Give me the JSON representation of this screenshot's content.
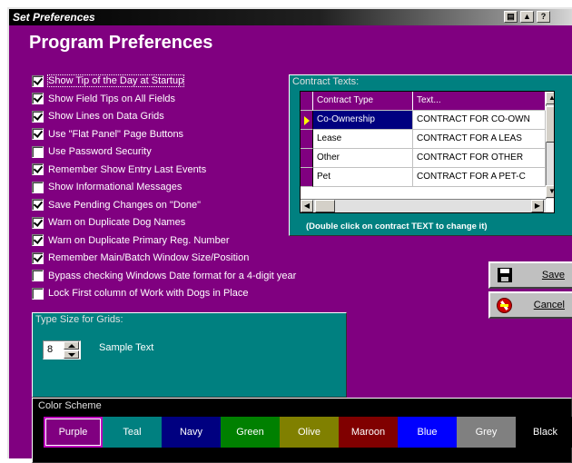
{
  "window": {
    "title": "Set Preferences",
    "heading": "Program Preferences",
    "bg_color": "#800080",
    "title_buttons": [
      "print-icon",
      "export-icon",
      "help-icon"
    ],
    "help_label": "?"
  },
  "options": [
    {
      "label": "Show Tip of the Day at Startup",
      "checked": true,
      "focused": true
    },
    {
      "label": "Show Field Tips on All Fields",
      "checked": true
    },
    {
      "label": "Show Lines on Data Grids",
      "checked": true
    },
    {
      "label": "Use \"Flat Panel\" Page Buttons",
      "checked": true
    },
    {
      "label": "Use Password Security",
      "checked": false
    },
    {
      "label": "Remember Show Entry Last Events",
      "checked": true
    },
    {
      "label": "Show Informational Messages",
      "checked": false
    },
    {
      "label": "Save Pending Changes on \"Done\"",
      "checked": true
    },
    {
      "label": "Warn on Duplicate Dog Names",
      "checked": true
    },
    {
      "label": "Warn on Duplicate Primary Reg. Number",
      "checked": true
    },
    {
      "label": "Remember Main/Batch Window Size/Position",
      "checked": true
    },
    {
      "label": "Bypass checking Windows Date format for a 4-digit year",
      "checked": false
    },
    {
      "label": "Lock First column of Work with Dogs in Place",
      "checked": false
    }
  ],
  "contract_texts": {
    "title": "Contract Texts:",
    "columns": [
      "Contract Type",
      "Text..."
    ],
    "rows": [
      {
        "type": "Co-Ownership",
        "text": "CONTRACT FOR CO-OWN",
        "selected": true
      },
      {
        "type": "Lease",
        "text": "CONTRACT FOR A LEAS"
      },
      {
        "type": "Other",
        "text": "CONTRACT FOR OTHER"
      },
      {
        "type": "Pet",
        "text": "CONTRACT FOR A PET-C"
      }
    ],
    "hint": "(Double click on contract TEXT to change it)"
  },
  "buttons": {
    "save_label": "Save",
    "cancel_label": "Cancel"
  },
  "type_size": {
    "title": "Type Size for Grids:",
    "value": "8",
    "sample": "Sample Text"
  },
  "color_scheme": {
    "title": "Color Scheme",
    "selected": "Purple",
    "options": [
      {
        "label": "Purple",
        "color": "#800080"
      },
      {
        "label": "Teal",
        "color": "#008080"
      },
      {
        "label": "Navy",
        "color": "#000080"
      },
      {
        "label": "Green",
        "color": "#008000"
      },
      {
        "label": "Olive",
        "color": "#808000"
      },
      {
        "label": "Maroon",
        "color": "#800000"
      },
      {
        "label": "Blue",
        "color": "#0000ff"
      },
      {
        "label": "Grey",
        "color": "#808080"
      },
      {
        "label": "Black",
        "color": "#000000"
      }
    ]
  }
}
